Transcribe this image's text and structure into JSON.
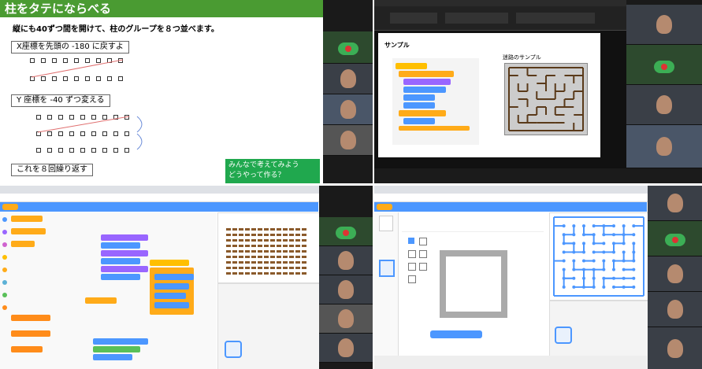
{
  "slide": {
    "title": "柱をタテにならべる",
    "subtitle": "縦にも40ずつ間を開けて、柱のグループを８つ並べます。",
    "step1": "X座標を先頭の -180 に戻すよ",
    "step2": "Y 座標を -40 ずつ変える",
    "step3": "これを８回繰り返す",
    "callout_line1": "みんなで考えてみよう",
    "callout_line2": "どうやって作る？"
  },
  "ppt": {
    "sample_label": "サンプル",
    "maze_label": "迷路のサンプル"
  },
  "colors": {
    "slide_green": "#4a9b32",
    "callout_green": "#20a84e",
    "scratch_blue": "#4c97ff",
    "motion_block": "#4c97ff",
    "looks_block": "#9966ff",
    "control_block": "#ffab19",
    "operator_block": "#59c059",
    "event_block": "#ffbf00"
  },
  "icons": [
    "green-flag-icon",
    "stop-icon",
    "scratch-logo-icon"
  ]
}
